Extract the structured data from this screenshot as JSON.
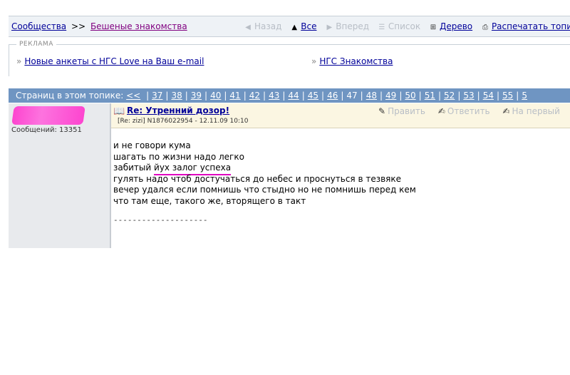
{
  "breadcrumb": {
    "root": "Сообщества",
    "separator": ">>",
    "current": "Бешеные знакомства"
  },
  "nav": {
    "back": "Назад",
    "all": "Все",
    "forward": "Вперед",
    "list": "Список",
    "tree": "Дерево",
    "print": "Распечатать топик"
  },
  "ad": {
    "legend": "РЕКЛАМА",
    "link1": "Новые анкеты с НГС Love на Ваш e-mail",
    "link2": "НГС Знакомства"
  },
  "pager": {
    "label": "Страниц в этом топике:",
    "prev": "<<",
    "pages": [
      "37",
      "38",
      "39",
      "40",
      "41",
      "42",
      "43",
      "44",
      "45",
      "46",
      "47",
      "48",
      "49",
      "50",
      "51",
      "52",
      "53",
      "54",
      "55",
      "5"
    ],
    "current": "47"
  },
  "author": {
    "messages": "Сообщений: 13351"
  },
  "post": {
    "title": "Re: Утренний дозор!",
    "meta": "[Re: zizi]  N1876022954 - 12.11.09 10:10",
    "actions": {
      "edit": "Править",
      "reply": "Ответить",
      "first": "На первый"
    },
    "lines": [
      "и не говори кума",
      "шагать по жизни надо легко",
      "забитый ",
      "гулять надо чтоб достучаться до небес и проснуться в тезвяке",
      "вечер удался если помнишь что стыдно но не помнишь перед кем",
      "что там еще, такого же, вторящего в такт"
    ],
    "highlight": "йух залог успеха",
    "divider": "--------------------"
  },
  "colors": {
    "link": "#000099",
    "pager_bg": "#6f95c2",
    "post_header_bg": "#fbf6e2",
    "highlight_underline": "#e000c0"
  }
}
